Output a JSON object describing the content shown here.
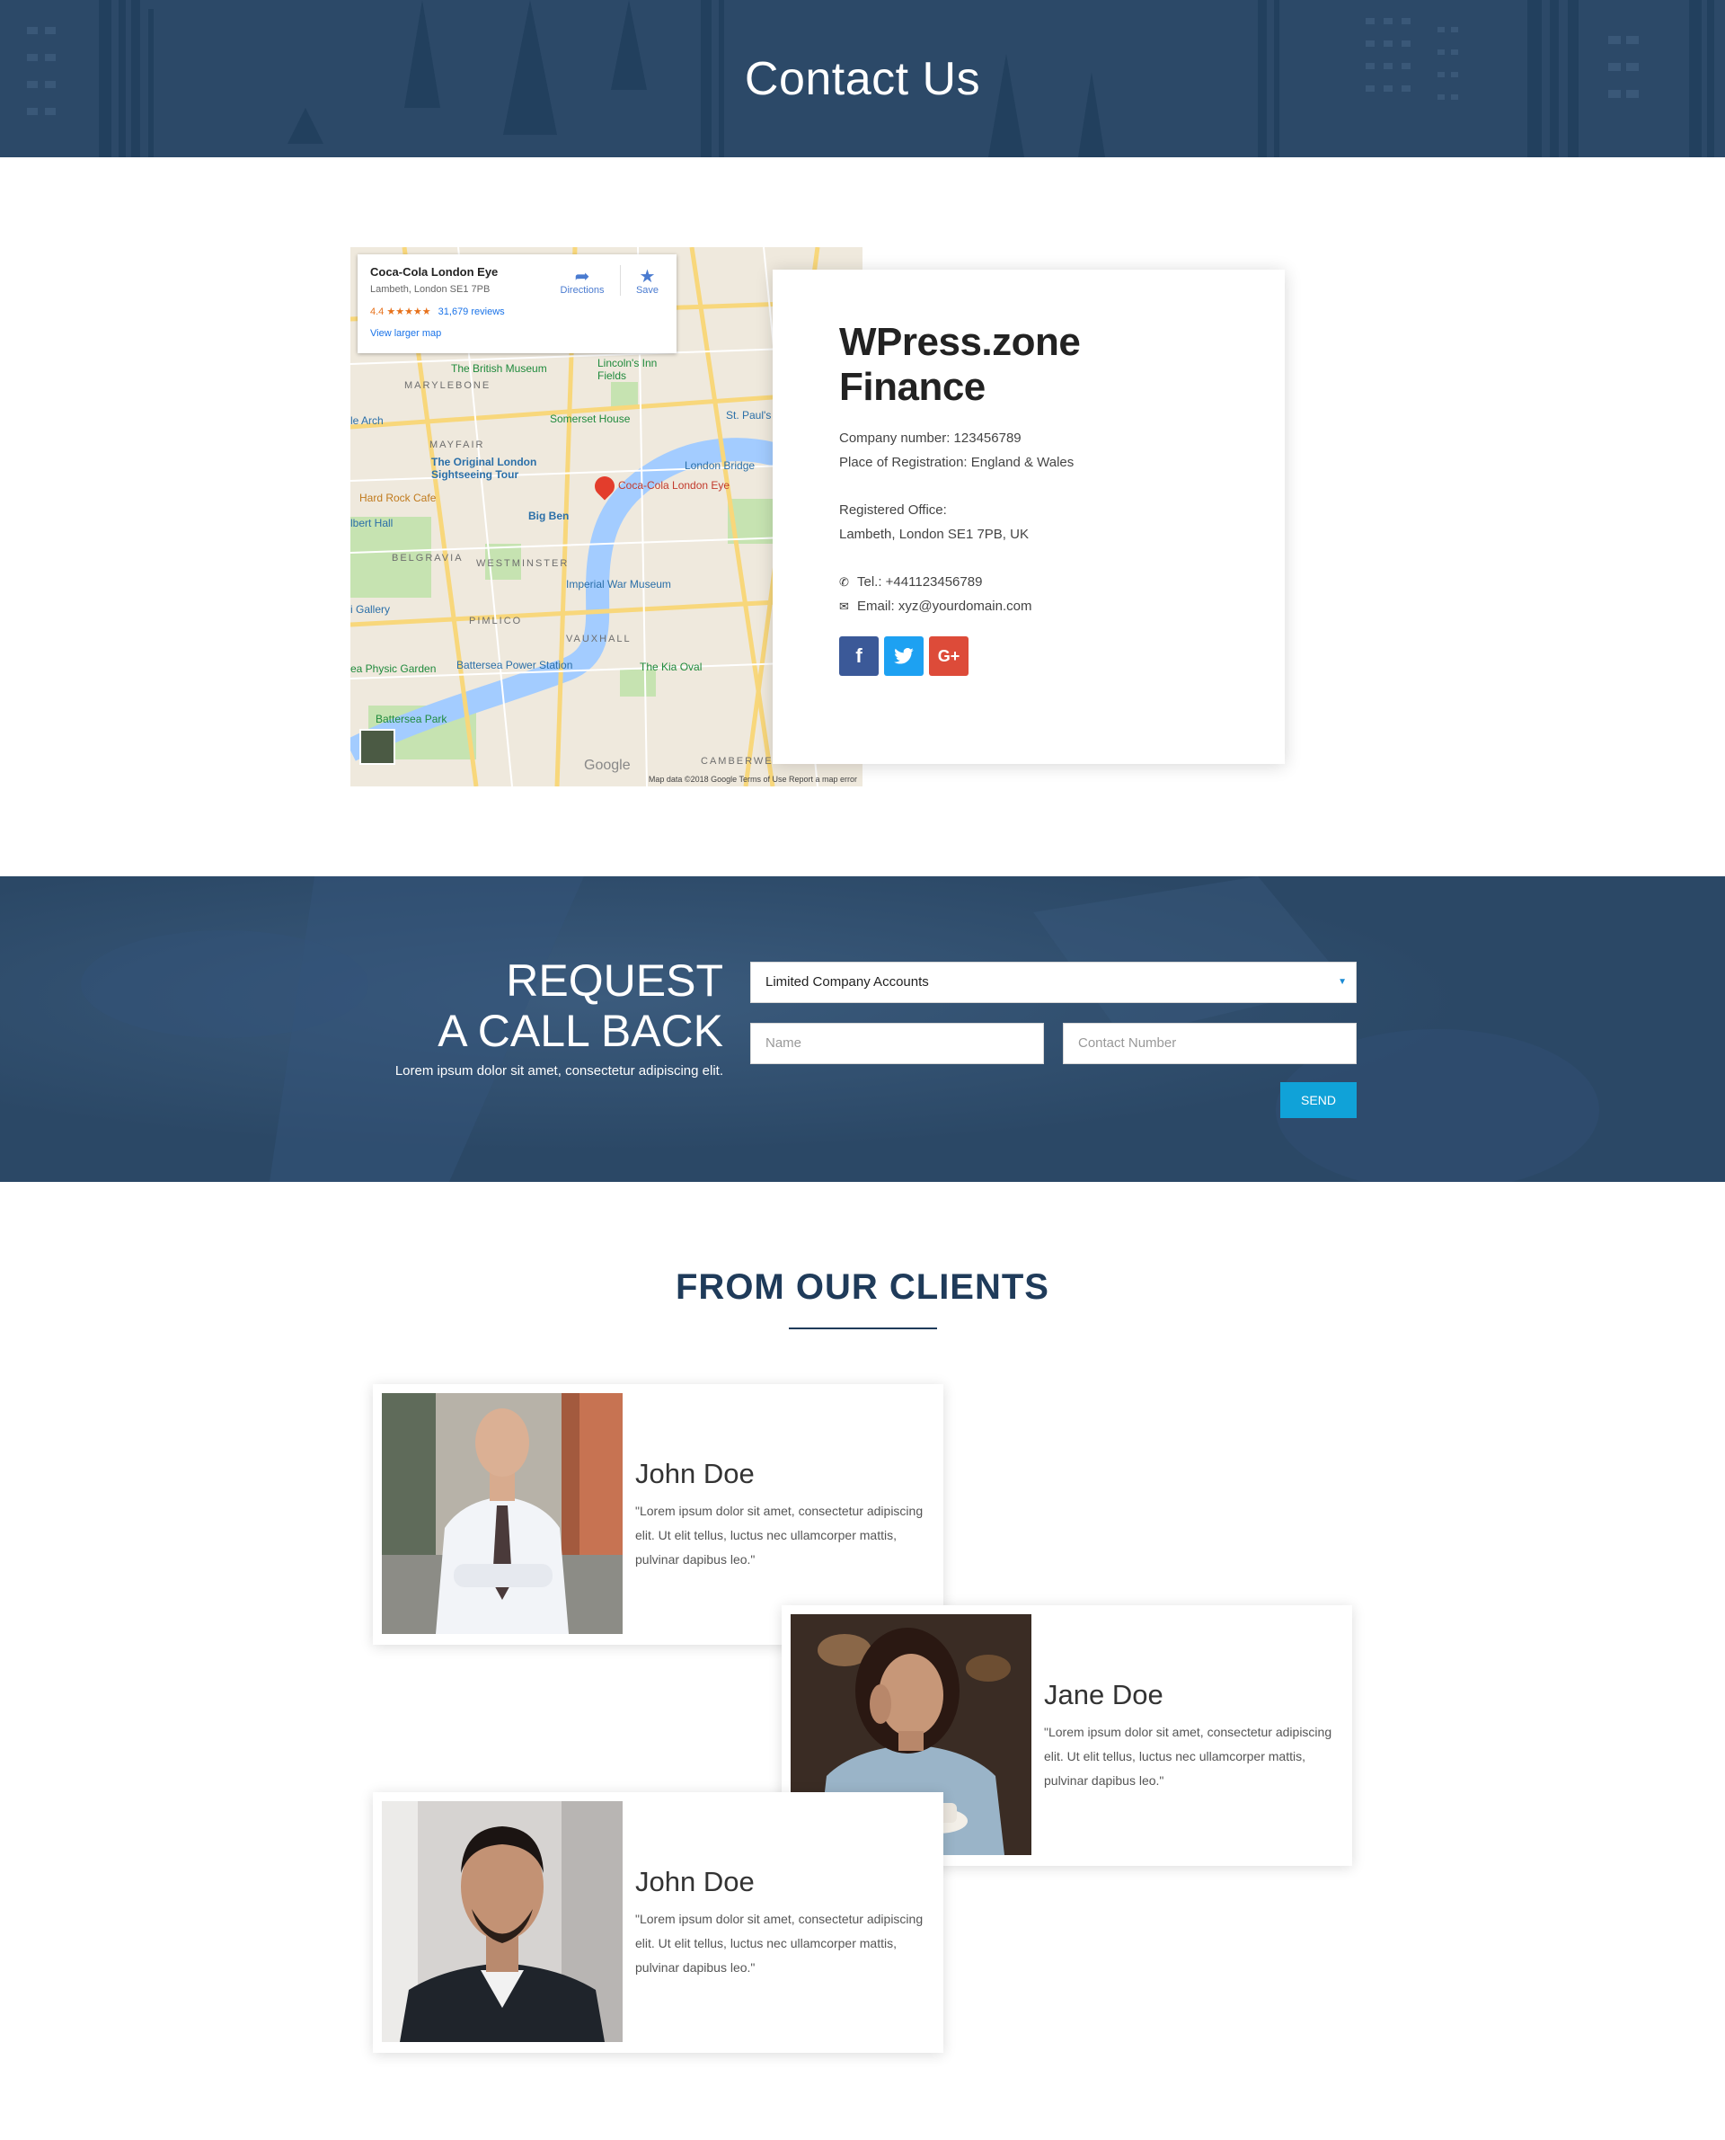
{
  "hero": {
    "title": "Contact Us"
  },
  "map": {
    "popup": {
      "title": "Coca-Cola London Eye",
      "address": "Lambeth, London SE1 7PB",
      "rating": "4.4 ★★★★★",
      "reviews": "31,679 reviews",
      "larger_map_link": "View larger map",
      "directions_label": "Directions",
      "save_label": "Save"
    },
    "labels": {
      "british_museum": "The British Museum",
      "lincolns": "Lincoln's Inn Fields",
      "marylebone": "MARYLEBONE",
      "somerset": "Somerset House",
      "mayfair": "MAYFAIR",
      "original_tour": "The Original London Sightseeing Tour",
      "london_bridge": "London Bridge",
      "london_eye": "Coca-Cola London Eye",
      "hard_rock": "Hard Rock Cafe",
      "big_ben": "Big Ben",
      "belgravia": "BELGRAVIA",
      "westminster": "WESTMINSTER",
      "imperial_war": "Imperial War Museum",
      "pimlico": "PIMLICO",
      "vauxhall": "VAUXHALL",
      "battersea_power": "Battersea Power Station",
      "kia_oval": "The Kia Oval",
      "battersea_park": "Battersea Park",
      "camberwell": "CAMBERWE",
      "physic_garden": "ea Physic Garden",
      "st_pauls": "St. Paul's",
      "hyde_arch": "le Arch",
      "albert_hall": "lbert Hall",
      "gallery": "i Gallery"
    },
    "footer": "Map data ©2018 Google   Terms of Use   Report a map error",
    "google": "Google"
  },
  "company": {
    "name": "WPress.zone Finance",
    "company_number": "Company number: 123456789",
    "registration": "Place of Registration: England & Wales",
    "office_label": "Registered Office:",
    "office_address": "Lambeth, London SE1 7PB, UK",
    "tel": "Tel.: +441123456789",
    "email": "Email: xyz@yourdomain.com",
    "social": {
      "facebook": "f",
      "twitter": "t",
      "google_plus": "G+"
    }
  },
  "callback": {
    "heading_line1": "REQUEST",
    "heading_line2": "A CALL BACK",
    "text": "Lorem ipsum dolor sit amet, consectetur adipiscing elit.",
    "select_value": "Limited Company Accounts",
    "name_placeholder": "Name",
    "phone_placeholder": "Contact Number",
    "send_label": "SEND"
  },
  "clients": {
    "title": "FROM OUR CLIENTS",
    "items": [
      {
        "name": "John Doe",
        "quote": "\"Lorem ipsum dolor sit amet, consectetur adipiscing elit. Ut elit tellus, luctus nec ullamcorper mattis, pulvinar dapibus leo.\""
      },
      {
        "name": "Jane Doe",
        "quote": "\"Lorem ipsum dolor sit amet, consectetur adipiscing elit. Ut elit tellus, luctus nec ullamcorper mattis, pulvinar dapibus leo.\""
      },
      {
        "name": "John Doe",
        "quote": "\"Lorem ipsum dolor sit amet, consectetur adipiscing elit. Ut elit tellus, luctus nec ullamcorper mattis, pulvinar dapibus leo.\""
      }
    ]
  },
  "colors": {
    "navy": "#2b4866",
    "heading": "#1f3b5a",
    "send": "#10a2d8",
    "facebook": "#3b5998",
    "twitter": "#1da1f2",
    "google_plus": "#dd4b39"
  }
}
